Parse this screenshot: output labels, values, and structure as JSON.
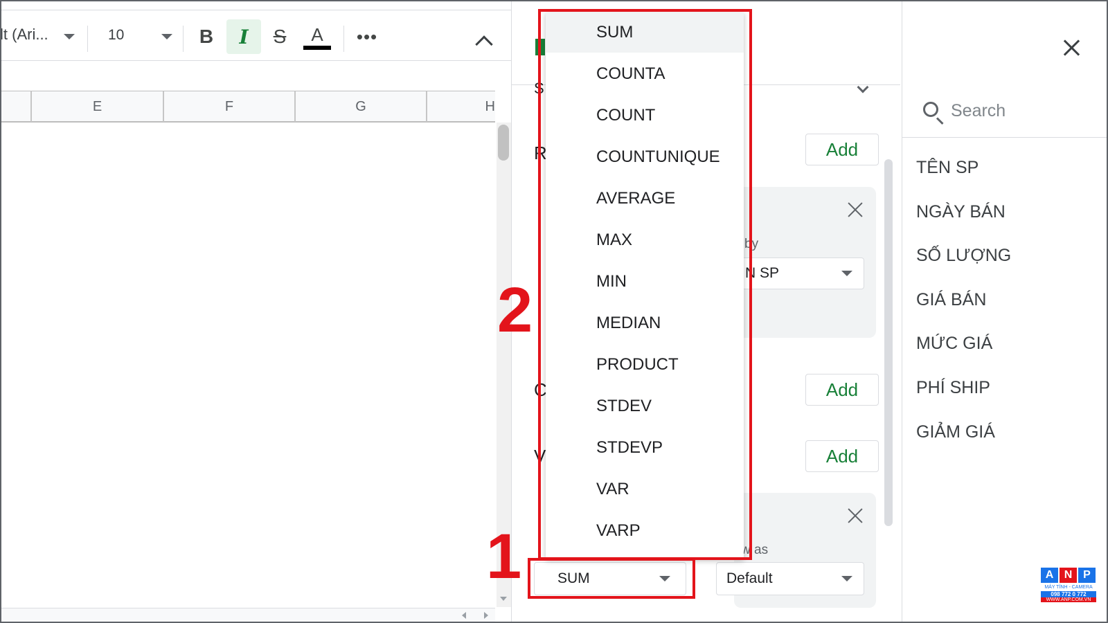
{
  "toolbar": {
    "font_name": "lt (Ari...",
    "font_size": "10",
    "bold": "B",
    "italic": "I",
    "strike": "S",
    "text_color": "A",
    "more": "•••"
  },
  "columns": [
    "E",
    "F",
    "G",
    "H"
  ],
  "editor": {
    "rows_fragment": "R",
    "columns_fragment": "C",
    "values_fragment": "V",
    "summarize_fragment": "S",
    "add_rows_label": "Add",
    "add_columns_label": "Add",
    "add_values_label": "Add",
    "rows_card_label": "by",
    "rows_card_select": "N SP",
    "values_card_label": "w as",
    "summarize_select": "SUM",
    "show_as_select": "Default"
  },
  "menu": {
    "items": [
      "SUM",
      "COUNTA",
      "COUNT",
      "COUNTUNIQUE",
      "AVERAGE",
      "MAX",
      "MIN",
      "MEDIAN",
      "PRODUCT",
      "STDEV",
      "STDEVP",
      "VAR",
      "VARP"
    ],
    "selected": "SUM"
  },
  "fields": {
    "search_placeholder": "Search",
    "items": [
      "TÊN SP",
      "NGÀY BÁN",
      "SỐ LƯỢNG",
      "GIÁ BÁN",
      "MỨC GIÁ",
      "PHÍ SHIP",
      "GIẢM GIÁ"
    ]
  },
  "annotations": {
    "step1": "1",
    "step2": "2"
  },
  "logo": {
    "letters": [
      "A",
      "N",
      "P"
    ],
    "tagline": "MÁY TÍNH - CAMERA",
    "phone": "098 772 0 772",
    "website": "WWW.ANP.COM.VN"
  },
  "colors": {
    "accent_green": "#188038",
    "annotation_red": "#e3141b",
    "selected_bg": "#f1f3f4"
  },
  "icons": [
    "caret-down-icon",
    "bold-icon",
    "italic-icon",
    "strikethrough-icon",
    "text-color-icon",
    "more-icon",
    "chevron-up-icon",
    "close-icon",
    "search-icon",
    "chevron-down-icon"
  ]
}
